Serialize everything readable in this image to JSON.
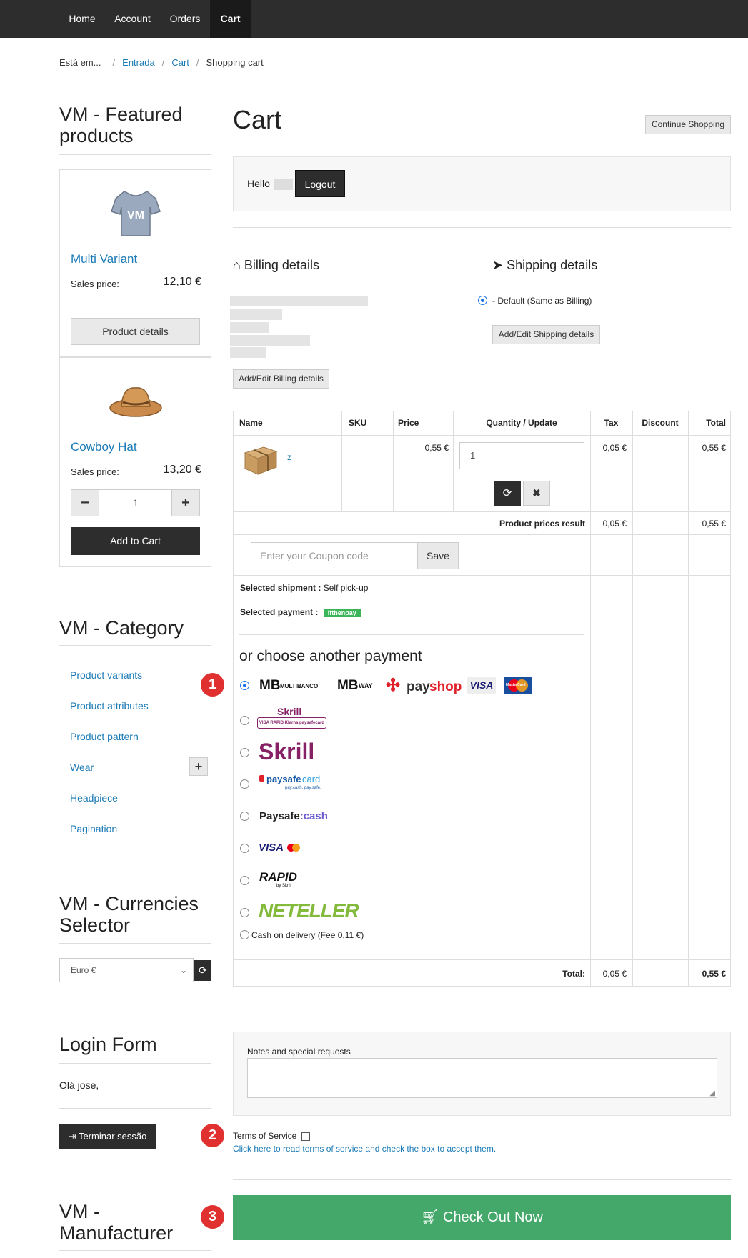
{
  "nav": {
    "items": [
      "Home",
      "Account",
      "Orders",
      "Cart"
    ],
    "active": "Cart"
  },
  "breadcrumb": {
    "prefix": "Está em...",
    "items": [
      "Entrada",
      "Cart"
    ],
    "current": "Shopping cart"
  },
  "sidebar": {
    "featured_title": "VM - Featured products",
    "products": [
      {
        "name": "Multi Variant",
        "price_label": "Sales price:",
        "price": "12,10 €",
        "button": "Product details"
      },
      {
        "name": "Cowboy Hat",
        "price_label": "Sales price:",
        "price": "13,20 €",
        "qty": "1",
        "button": "Add to Cart"
      }
    ],
    "category_title": "VM - Category",
    "categories": [
      "Product variants",
      "Product attributes",
      "Product pattern",
      "Wear",
      "Headpiece",
      "Pagination"
    ],
    "currency_title": "VM - Currencies Selector",
    "currency_selected": "Euro €",
    "login_title": "Login Form",
    "greeting": "Olá jose,",
    "logout_button": "Terminar sessão",
    "manufacturer_title": "VM - Manufacturer"
  },
  "cart": {
    "title": "Cart",
    "continue_button": "Continue Shopping",
    "hello": "Hello",
    "logout_button": "Logout",
    "billing_title": "Billing details",
    "billing_button": "Add/Edit Billing details",
    "shipping_title": "Shipping details",
    "shipping_default": "- Default (Same as Billing)",
    "shipping_button": "Add/Edit Shipping details",
    "columns": [
      "Name",
      "SKU",
      "Price",
      "Quantity / Update",
      "Tax",
      "Discount",
      "Total"
    ],
    "item": {
      "name": "z",
      "price": "0,55 €",
      "qty": "1",
      "tax": "0,05 €",
      "total": "0,55 €"
    },
    "result_label": "Product prices result",
    "result_tax": "0,05 €",
    "result_total": "0,55 €",
    "coupon_placeholder": "Enter your Coupon code",
    "coupon_button": "Save",
    "shipment_label": "Selected shipment :",
    "shipment_value": "Self pick-up",
    "payment_label": "Selected payment :",
    "payment_badge": "Ifthenpay",
    "choose_payment": "or choose another payment",
    "payment_logos": {
      "multibanco": "MULTIBANCO",
      "mbway": "WAY",
      "payshop_a": "pay",
      "payshop_b": "shop",
      "visa": "VISA",
      "mastercard": "MasterCard",
      "skrill_klarna_title": "Skrill",
      "skrill_klarna_sub": "VISA  RAPID  Klarna  paysafecard",
      "skrill": "Skrill",
      "paysafecard_a": "paysafe",
      "paysafecard_b": "card",
      "paysafecard_sub": "pay.cash. pay.safe.",
      "paysafecash_a": "Paysafe",
      "paysafecash_b": ":cash",
      "visa_small": "VISA",
      "rapid": "RAPID",
      "rapid_sub": "by Skrill",
      "neteller": "NETELLER"
    },
    "cash_on_delivery": "Cash on delivery (Fee 0,11 €)",
    "total_label": "Total:",
    "total_tax": "0,05 €",
    "total_value": "0,55 €",
    "notes_label": "Notes and special requests",
    "tos_label": "Terms of Service",
    "tos_link": "Click here to read terms of service and check the box to accept them.",
    "checkout_button": "Check Out Now"
  },
  "markers": [
    "1",
    "2",
    "3"
  ],
  "colors": {
    "accent": "#1a7ab5",
    "checkout": "#43a86a",
    "marker": "#e03030",
    "dark": "#2d2d2d"
  }
}
